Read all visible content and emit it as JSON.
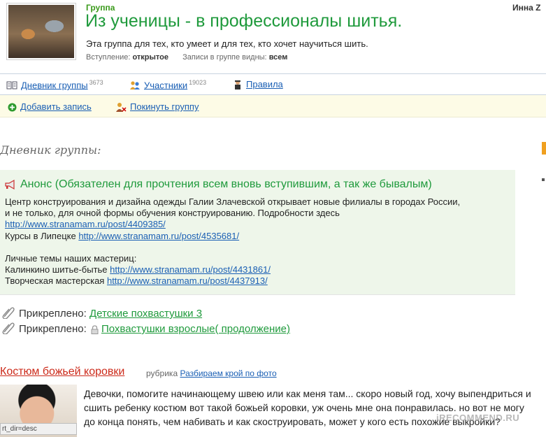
{
  "header": {
    "group_label": "Группа",
    "title": "Из ученицы - в профессионалы шитья.",
    "description": "Эта группа для тех, кто умеет и для тех, кто хочет научиться шить.",
    "entry_label": "Вступление:",
    "entry_value": "открытое",
    "visibility_label": "Записи в группе видны:",
    "visibility_value": "всем",
    "user_name": "Инна Z"
  },
  "nav": {
    "diary_label": "Дневник группы",
    "diary_count": "3673",
    "members_label": "Участники",
    "members_count": "19023",
    "rules_label": "Правила"
  },
  "actions": {
    "add_post": "Добавить запись",
    "leave_group": "Покинуть группу"
  },
  "diary_heading": "Дневник группы:",
  "announcement": {
    "title": "Анонс (Обязателен для прочтения всем вновь вступившим, а так же бывалым)",
    "line1": "Центр конструирования и дизайна одежды Галии Злачевской открывает новые филиалы в городах России,",
    "line2": "и не только, для очной формы обучения конструированию. Подробности здесь",
    "link1": "http://www.stranamam.ru/post/4409385/",
    "lipetsk_label": "Курсы в Липецке",
    "link2": "http://www.stranamam.ru/post/4535681/",
    "masters_heading": "Личные темы наших мастериц:",
    "kalinkino_label": "Калинкино шитье-бытье",
    "link3": "http://www.stranamam.ru/post/4431861/",
    "workshop_label": "Творческая мастерская",
    "link4": "http://www.stranamam.ru/post/4437913/"
  },
  "pinned": [
    {
      "label": "Прикреплено:",
      "title": "Детские похвастушки 3"
    },
    {
      "label": "Прикреплено:",
      "title": "Похвастушки взрослые( продолжение)"
    }
  ],
  "post": {
    "title": "Костюм божьей коровки",
    "rubric_label": "рубрика",
    "rubric_link": "Разбираем крой по фото",
    "text": "Девочки, помогите начинающему швею или как меня там... скоро новый год, хочу выпендриться и сшить ребенку костюм вот такой божьей коровки, уж очень мне она понравилась. но вот не могу до конца понять, чем набивать и как скоструировать, может у кого есть похожие выкройки?"
  },
  "status_bar": "rt_dir=desc",
  "watermark": "iRECOMMEND.RU",
  "colors": {
    "title_green": "#1f9a3c",
    "link_blue": "#1a5fb4",
    "post_red": "#cc2a1a",
    "announce_bg": "#eef6ea",
    "action_bg": "#fdfbe6"
  }
}
